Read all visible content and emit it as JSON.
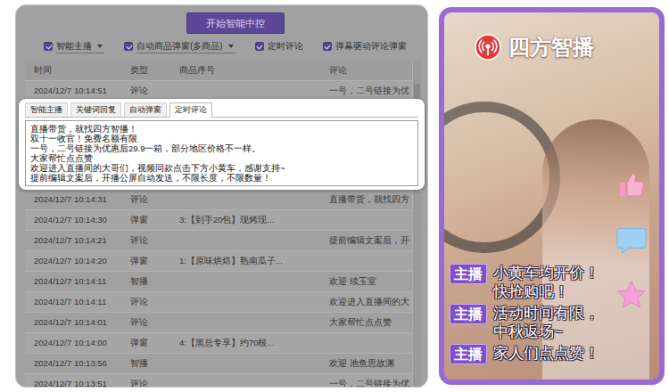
{
  "control": {
    "start_button": "开始智能中控",
    "options": [
      {
        "label": "智能主播",
        "checked": true,
        "dropdown": true
      },
      {
        "label": "自动商品弹窗(多商品)",
        "checked": true,
        "dropdown": true
      },
      {
        "label": "定时评论",
        "checked": true,
        "dropdown": false
      },
      {
        "label": "弹幕驱动评论弹窗",
        "checked": true,
        "dropdown": false
      }
    ],
    "table": {
      "columns": [
        "时间",
        "类型",
        "商品序号",
        "评论"
      ],
      "rows_above": [
        [
          "2024/12/7 10:14:51",
          "评论",
          "",
          "一号，二号链接为优"
        ]
      ],
      "rows_below": [
        [
          "2024/12/7 10:14:31",
          "评论",
          "",
          "直播带货，就找四方"
        ],
        [
          "2024/12/7 10:14:30",
          "弹窗",
          "3:【到手20包】现烤现...",
          ""
        ],
        [
          "2024/12/7 10:14:21",
          "评论",
          "",
          "提前编辑文案后，开"
        ],
        [
          "2024/12/7 10:14:20",
          "弹窗",
          "1:【原味烘焙】熟南瓜子...",
          ""
        ],
        [
          "2024/12/7 10:14:11",
          "智播",
          "",
          "欢迎 续玉室"
        ],
        [
          "2024/12/7 10:14:11",
          "评论",
          "",
          "欢迎进入直播间的大"
        ],
        [
          "2024/12/7 10:14:01",
          "评论",
          "",
          "大家帮忙点点赞"
        ],
        [
          "2024/12/7 10:14:00",
          "弹窗",
          "4:【黑总专享】约70根...",
          ""
        ],
        [
          "2024/12/7 10:13:56",
          "智播",
          "",
          "欢迎 池鱼思故渊"
        ],
        [
          "2024/12/7 10:13:51",
          "评论",
          "",
          "一号，二号链接为优"
        ]
      ]
    },
    "popup": {
      "tabs": [
        {
          "label": "智能主播",
          "selected": false
        },
        {
          "label": "关键词回复",
          "selected": false
        },
        {
          "label": "自动弹窗",
          "selected": false
        },
        {
          "label": "定时评论",
          "selected": true
        }
      ],
      "lines": [
        "直播带货，就找四方智播！",
        "双十一收官！免费名额有限",
        "一号，二号链接为优惠后29.9一箱，部分地区价格不一样。",
        "大家帮忙点点赞",
        "欢迎进入直播间的大哥们，视频同款点击下方小黄车，感谢支持~",
        "提前编辑文案后，开播公屏自动发送，不限长度，不限数量！"
      ]
    }
  },
  "preview": {
    "brand": "四方智播",
    "messages": [
      {
        "role": "主播",
        "lines": [
          "小黄车均开价！",
          "快抢购吧！"
        ]
      },
      {
        "role": "主播",
        "lines": [
          "活动时间有限，",
          "中秋返场~"
        ]
      },
      {
        "role": "主播",
        "lines": [
          "家人们点点赞！"
        ]
      }
    ]
  }
}
